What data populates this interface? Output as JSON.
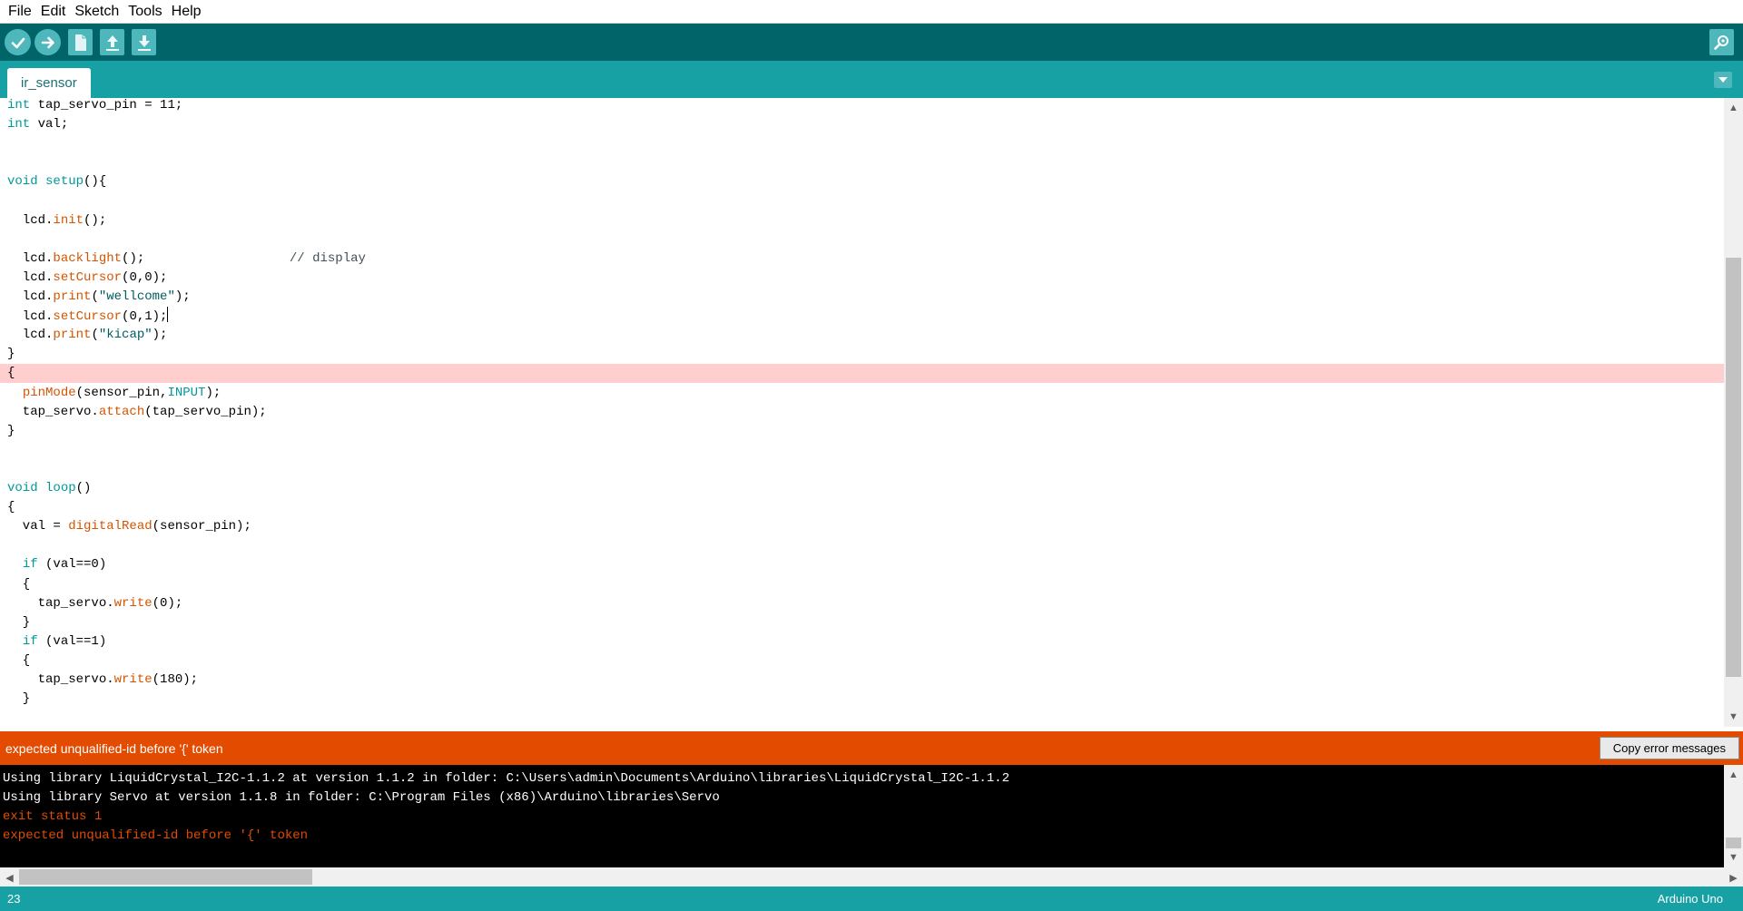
{
  "menu": [
    "File",
    "Edit",
    "Sketch",
    "Tools",
    "Help"
  ],
  "toolbar": {
    "icons": [
      "verify-check-icon",
      "upload-arrow-icon",
      "new-sketch-icon",
      "open-sketch-icon",
      "save-sketch-icon",
      "serial-monitor-icon"
    ]
  },
  "tabs": [
    {
      "label": "ir_sensor"
    }
  ],
  "editor": {
    "lines": [
      "int tap_servo_pin = 11;",
      "int val;",
      "",
      "",
      "void setup(){",
      "",
      "  lcd.init();",
      "",
      "  lcd.backlight();                   // display",
      "  lcd.setCursor(0,0);",
      "  lcd.print(\"wellcome\");",
      "  lcd.setCursor(0,1);",
      "  lcd.print(\"kicap\");",
      "}",
      "{",
      "  pinMode(sensor_pin,INPUT);",
      "  tap_servo.attach(tap_servo_pin);",
      "}",
      "",
      "",
      "void loop()",
      "{",
      "  val = digitalRead(sensor_pin);",
      "",
      "  if (val==0)",
      "  {",
      "    tap_servo.write(0);",
      "  }",
      "  if (val==1)",
      "  {",
      "    tap_servo.write(180);",
      "  }"
    ],
    "error_line_index": 14,
    "cursor_line_index": 11
  },
  "error_bar": {
    "message": "expected unqualified-id before '{' token",
    "copy_button_label": "Copy error messages"
  },
  "console": {
    "lines": [
      {
        "text": "Using library LiquidCrystal_I2C-1.1.2 at version 1.1.2 in folder: C:\\Users\\admin\\Documents\\Arduino\\libraries\\LiquidCrystal_I2C-1.1.2",
        "type": "info"
      },
      {
        "text": "Using library Servo at version 1.1.8 in folder: C:\\Program Files (x86)\\Arduino\\libraries\\Servo",
        "type": "info"
      },
      {
        "text": "exit status 1",
        "type": "error"
      },
      {
        "text": "expected unqualified-id before '{' token",
        "type": "error"
      }
    ]
  },
  "status": {
    "line_number": "23",
    "board": "Arduino Uno"
  },
  "colors": {
    "toolbar_bg": "#006468",
    "tab_bar_bg": "#17a1a5",
    "error_bar_bg": "#e34c00",
    "error_line_bg": "#ffcfcf",
    "keyword": "#00979c",
    "function": "#d35400"
  }
}
